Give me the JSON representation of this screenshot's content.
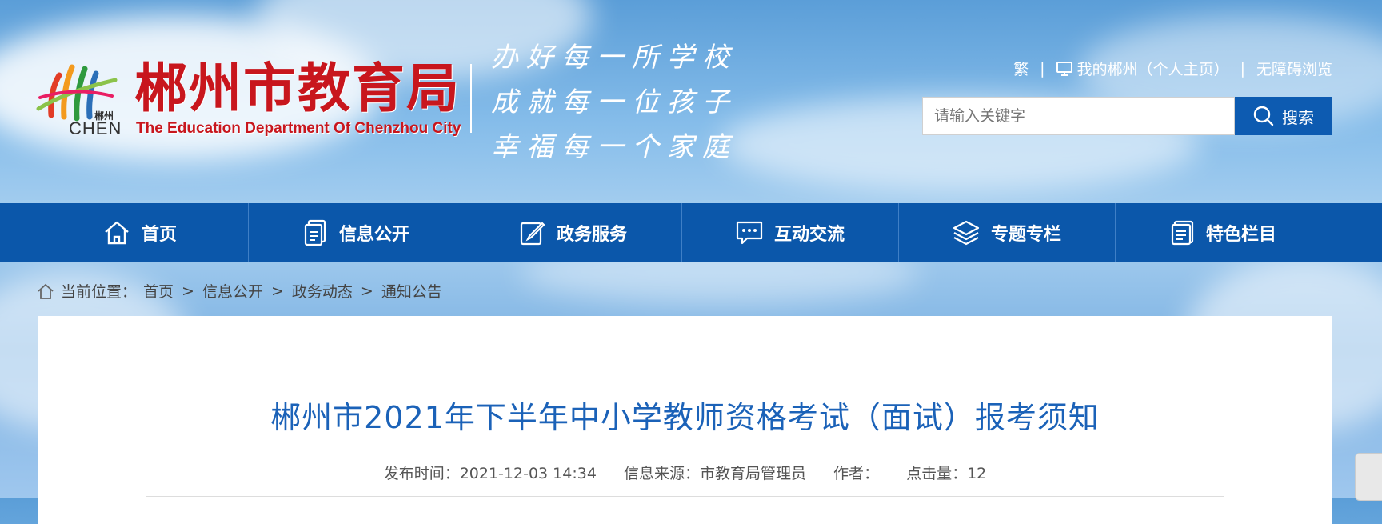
{
  "header": {
    "logo_title": "郴州市教育局",
    "logo_subtitle": "The Education Department Of Chenzhou City",
    "logo_small": "郴州",
    "logo_chen": "CHEN",
    "slogans": [
      "办好每一所学校",
      "成就每一位孩子",
      "幸福每一个家庭"
    ],
    "toplinks": {
      "traditional": "繁",
      "my_chenzhou": "我的郴州（个人主页）",
      "accessibility": "无障碍浏览",
      "separator": "|"
    },
    "search": {
      "placeholder": "请输入关键字",
      "button_label": "搜索"
    }
  },
  "nav": {
    "items": [
      {
        "label": "首页",
        "icon": "home-icon"
      },
      {
        "label": "信息公开",
        "icon": "document-icon"
      },
      {
        "label": "政务服务",
        "icon": "edit-icon"
      },
      {
        "label": "互动交流",
        "icon": "chat-icon"
      },
      {
        "label": "专题专栏",
        "icon": "layers-icon"
      },
      {
        "label": "特色栏目",
        "icon": "list-icon"
      }
    ]
  },
  "breadcrumb": {
    "prefix": "当前位置：",
    "items": [
      "首页",
      "信息公开",
      "政务动态",
      "通知公告"
    ],
    "separator": ">"
  },
  "article": {
    "title": "郴州市2021年下半年中小学教师资格考试（面试）报考须知",
    "publish_time": "发布时间：2021-12-03 14:34",
    "source": "信息来源：市教育局管理员",
    "author": "作者：",
    "views": "点击量：12"
  },
  "colors": {
    "nav_bg": "#0b57aa",
    "title_blue": "#1b62b8",
    "logo_red": "#c8161d"
  }
}
